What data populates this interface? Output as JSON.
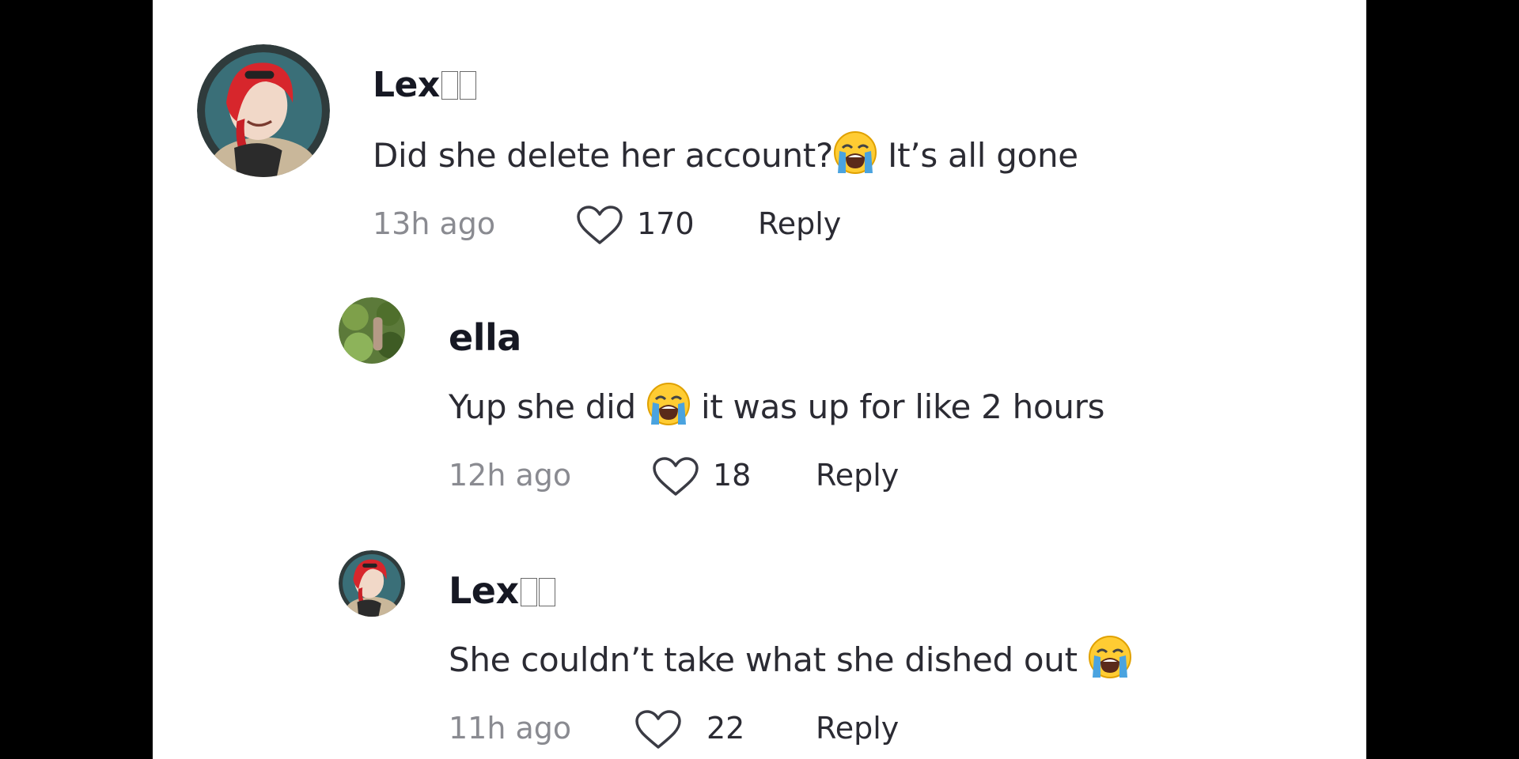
{
  "colors": {
    "background_frame": "#000000",
    "panel": "#ffffff",
    "username": "#161823",
    "body_text": "#2b2b33",
    "timestamp": "#8a8b91"
  },
  "comments": [
    {
      "username": "Lex",
      "text_before": "Did she delete her account?",
      "emoji": "loudly-crying-face-icon",
      "text_after": " It’s all gone",
      "time": "13h ago",
      "likes": "170",
      "reply_label": "Reply"
    },
    {
      "username": "ella",
      "text_before": "Yup she did ",
      "emoji": "loudly-crying-face-icon",
      "text_after": " it was up for like 2 hours",
      "time": "12h ago",
      "likes": "18",
      "reply_label": "Reply"
    },
    {
      "username": "Lex",
      "text_before": "She couldn’t take what she dished out ",
      "emoji": "loudly-crying-face-icon",
      "text_after": "",
      "time": "11h ago",
      "likes": "22",
      "reply_label": "Reply"
    }
  ]
}
